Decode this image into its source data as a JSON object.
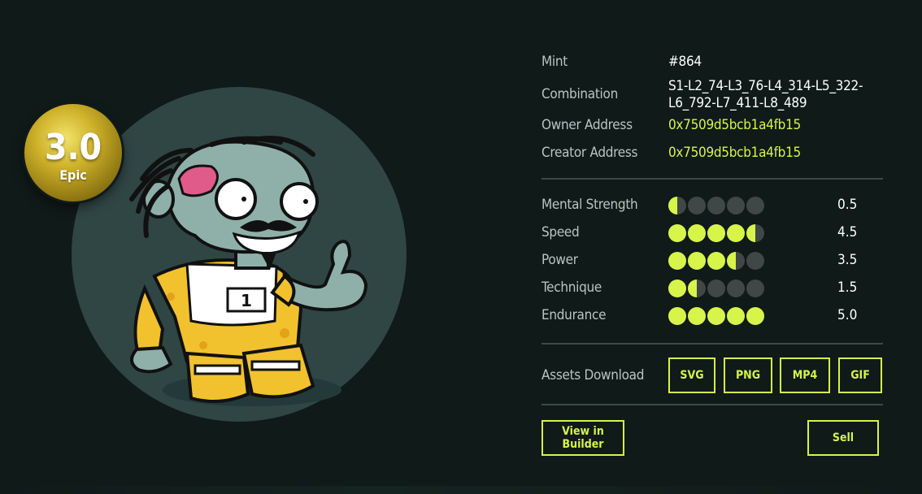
{
  "rarity": {
    "score": "3.0",
    "tier": "Epic"
  },
  "details": {
    "mint_label": "Mint",
    "mint_value": "#864",
    "combination_label": "Combination",
    "combination_line1": "S1-L2_74-L3_76-L4_314-L5_322-",
    "combination_line2": "L6_792-L7_411-L8_489",
    "owner_label": "Owner Address",
    "owner_value": "0x7509d5bcb1a4fb15",
    "creator_label": "Creator Address",
    "creator_value": "0x7509d5bcb1a4fb15"
  },
  "stats": [
    {
      "name": "Mental Strength",
      "value": 0.5,
      "display": "0.5"
    },
    {
      "name": "Speed",
      "value": 4.5,
      "display": "4.5"
    },
    {
      "name": "Power",
      "value": 3.5,
      "display": "3.5"
    },
    {
      "name": "Technique",
      "value": 1.5,
      "display": "1.5"
    },
    {
      "name": "Endurance",
      "value": 5.0,
      "display": "5.0"
    }
  ],
  "stat_max": 5,
  "assets": {
    "label": "Assets Download",
    "buttons": [
      "SVG",
      "PNG",
      "MP4",
      "GIF"
    ]
  },
  "actions": {
    "view_builder": "View in Builder",
    "sell": "Sell"
  },
  "character": {
    "jersey_number": "1"
  },
  "colors": {
    "background": "#0f1a19",
    "accent": "#d7f44a",
    "badge_gold": "#cdb12a",
    "backdrop": "#2f4644",
    "dot_empty": "#3f4847"
  }
}
